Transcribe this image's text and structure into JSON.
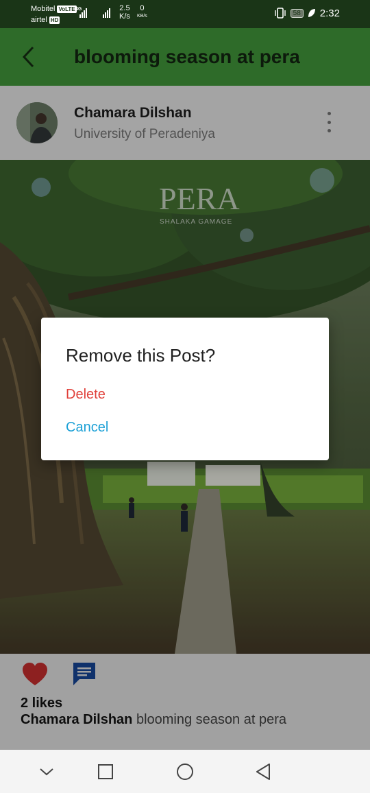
{
  "status_bar": {
    "carrier1": "Mobitel",
    "carrier1_badge": "VoLTE",
    "carrier2": "airtel",
    "carrier2_badge": "HD",
    "network": "4G",
    "speed_value": "2.5",
    "speed_unit": "K/s",
    "data_value": "0",
    "data_unit": "KB/s",
    "battery": "58",
    "time": "2:32"
  },
  "app_bar": {
    "title": "blooming season at pera",
    "back_icon": "chevron-left-icon"
  },
  "post": {
    "author_name": "Chamara Dilshan",
    "author_subtitle": "University of Peradeniya",
    "more_icon": "more-vertical-icon",
    "image_watermark_title": "PERA",
    "image_watermark_sub": "SHALAKA GAMAGE",
    "likes_text": "2 likes",
    "caption_author": "Chamara Dilshan",
    "caption_text": "blooming season at pera"
  },
  "dialog": {
    "title": "Remove this Post?",
    "delete_label": "Delete",
    "cancel_label": "Cancel"
  },
  "colors": {
    "app_bar": "#2e6b29",
    "status_bar": "#1a3517",
    "delete": "#e0403a",
    "cancel": "#1ba0d6",
    "like": "#b52a2a",
    "comment": "#143f8a"
  },
  "nav_bar": {
    "icons": [
      "chevron-down-icon",
      "square-recent-icon",
      "circle-home-icon",
      "triangle-back-icon"
    ]
  }
}
